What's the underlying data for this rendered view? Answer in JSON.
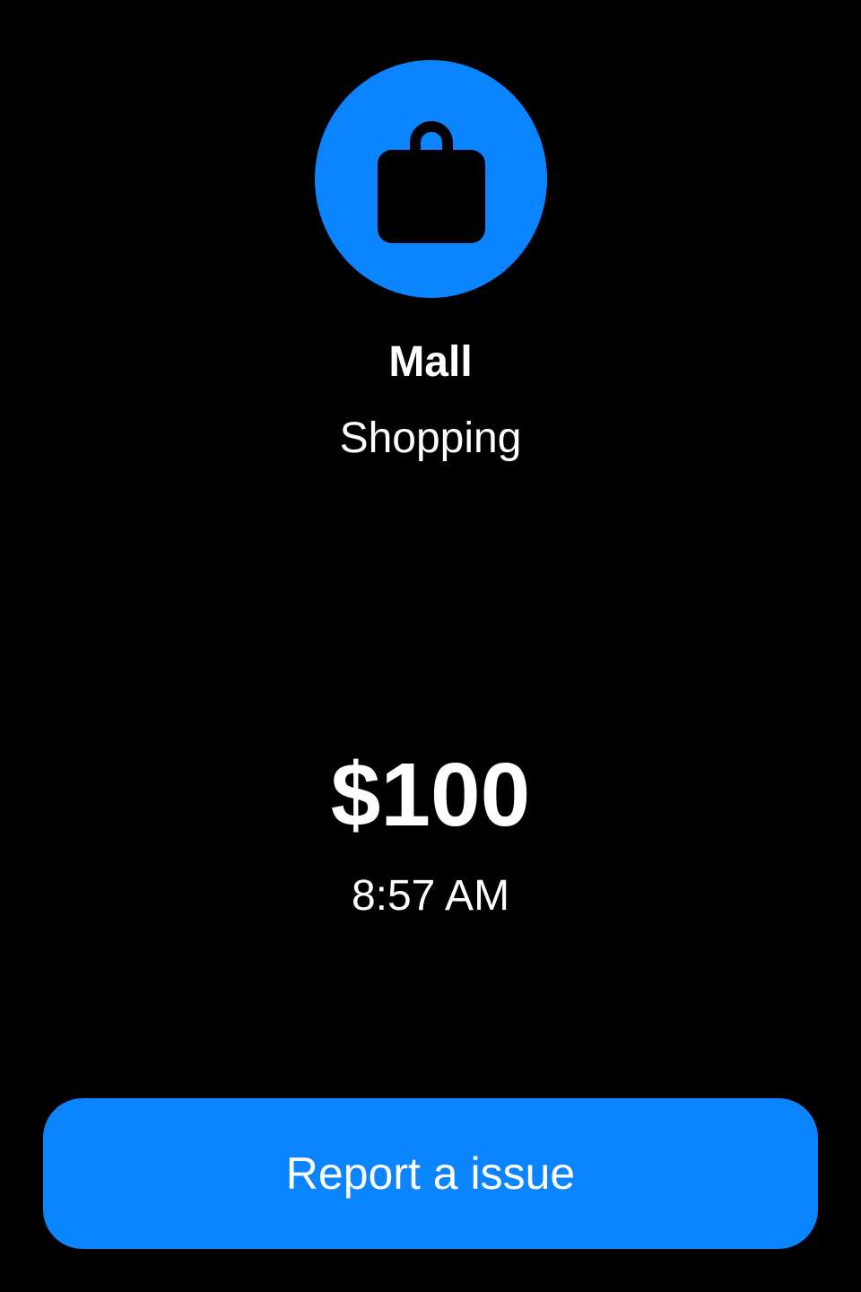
{
  "transaction": {
    "icon": "shopping-bag-icon",
    "merchant": "Mall",
    "category": "Shopping",
    "amount": "$100",
    "time": "8:57 AM"
  },
  "actions": {
    "report_label": "Report a issue"
  },
  "colors": {
    "accent": "#0a84ff",
    "background": "#000000",
    "text": "#ffffff"
  }
}
